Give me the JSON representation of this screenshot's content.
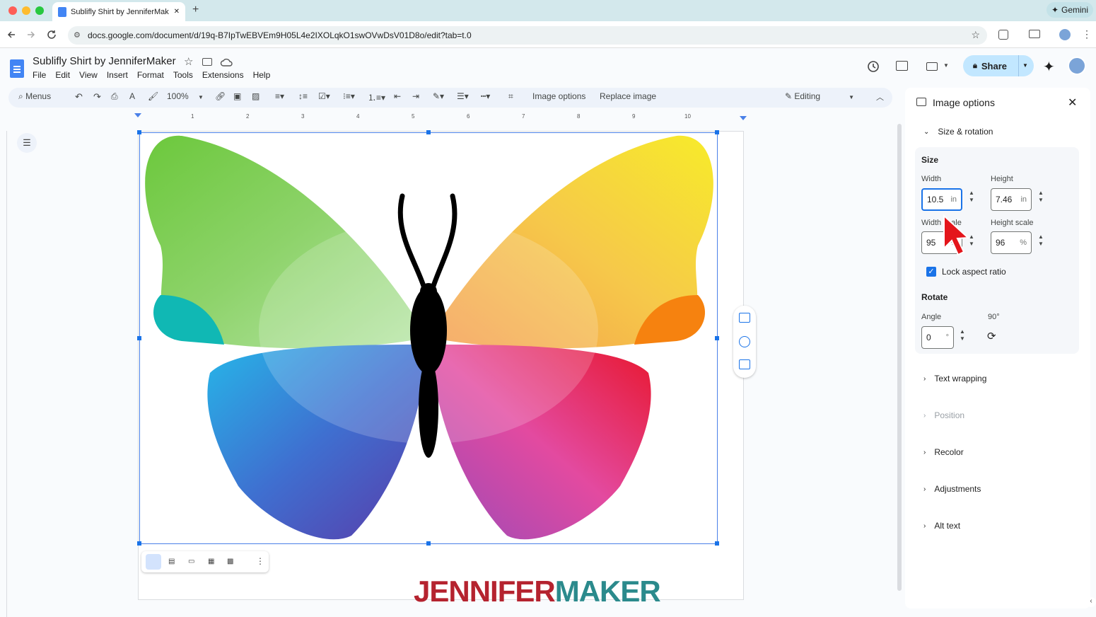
{
  "browser": {
    "tab_title": "Sublifly Shirt by JenniferMak",
    "url": "docs.google.com/document/d/19q-B7IpTwEBVEm9H05L4e2IXOLqkO1swOVwDsV01D8o/edit?tab=t.0",
    "gemini_label": "Gemini",
    "new_tab": "+",
    "close_tab": "✕"
  },
  "docs": {
    "title": "Sublifly Shirt by JenniferMaker",
    "menu": [
      "File",
      "Edit",
      "View",
      "Insert",
      "Format",
      "Tools",
      "Extensions",
      "Help"
    ],
    "share_label": "Share",
    "toolbar": {
      "search_menus": "Menus",
      "zoom": "100%",
      "image_options": "Image options",
      "replace_image": "Replace image",
      "mode": "Editing"
    },
    "ruler_ticks": [
      "1",
      "2",
      "3",
      "4",
      "5",
      "6",
      "7",
      "8",
      "9",
      "10"
    ],
    "logo": {
      "part1": "JENNIFER",
      "part2": "MAKER"
    }
  },
  "panel": {
    "title": "Image options",
    "size_rotation": "Size & rotation",
    "size_heading": "Size",
    "width_label": "Width",
    "height_label": "Height",
    "width_value": "10.5",
    "height_value": "7.46",
    "unit": "in",
    "width_scale_label": "Width scale",
    "height_scale_label": "Height scale",
    "width_scale_value": "95",
    "height_scale_value": "96",
    "pct": "%",
    "lock_aspect": "Lock aspect ratio",
    "lock_checked": true,
    "rotate_heading": "Rotate",
    "angle_label": "Angle",
    "angle_value": "0",
    "deg": "°",
    "rotate90_label": "90°",
    "sections": [
      "Text wrapping",
      "Position",
      "Recolor",
      "Adjustments",
      "Alt text"
    ]
  },
  "colors": {
    "accent": "#1a73e8",
    "share_bg": "#c2e7ff",
    "logo_red": "#b5232f",
    "logo_teal": "#2b8a8c"
  }
}
